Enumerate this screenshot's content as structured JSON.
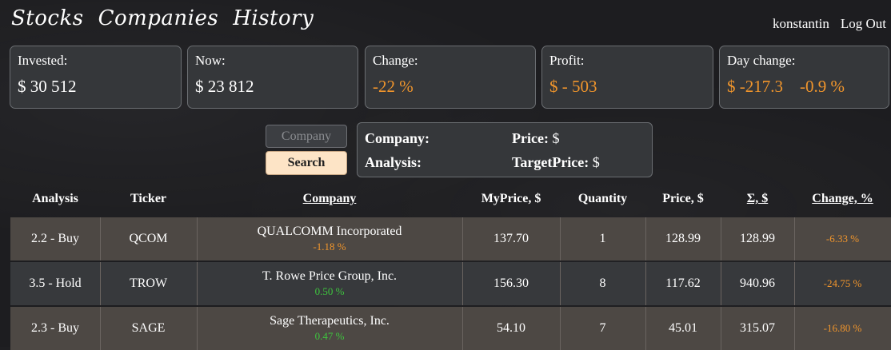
{
  "nav": {
    "links": [
      "Stocks",
      "Companies",
      "History"
    ],
    "username": "konstantin",
    "logout": "Log Out"
  },
  "summary": {
    "invested": {
      "label": "Invested:",
      "value": "$ 30 512"
    },
    "now": {
      "label": "Now:",
      "value": "$ 23 812"
    },
    "change": {
      "label": "Change:",
      "value": "-22 %"
    },
    "profit": {
      "label": "Profit:",
      "value": "$ - 503"
    },
    "day_change": {
      "label": "Day change:",
      "value": "$ -217.3    -0.9 %"
    }
  },
  "controls": {
    "company_button": "Company",
    "search_button": "Search"
  },
  "info": {
    "company_label": "Company:",
    "price_label": "Price:",
    "price_unit": "$",
    "analysis_label": "Analysis:",
    "target_label": "TargetPrice:",
    "target_unit": "$"
  },
  "table": {
    "headers": {
      "analysis": "Analysis",
      "ticker": "Ticker",
      "company": "Company",
      "myprice": "MyPrice, $",
      "quantity": "Quantity",
      "price": "Price, $",
      "sum": "Σ, $",
      "change": "Change, %"
    },
    "rows": [
      {
        "analysis": "2.2 - Buy",
        "ticker": "QCOM",
        "company": "QUALCOMM Incorporated",
        "day_change": "-1.18 %",
        "myprice": "137.70",
        "quantity": "1",
        "price": "128.99",
        "sum": "128.99",
        "change": "-6.33 %"
      },
      {
        "analysis": "3.5 - Hold",
        "ticker": "TROW",
        "company": "T. Rowe Price Group, Inc.",
        "day_change": "0.50 %",
        "myprice": "156.30",
        "quantity": "8",
        "price": "117.62",
        "sum": "940.96",
        "change": "-24.75 %"
      },
      {
        "analysis": "2.3 - Buy",
        "ticker": "SAGE",
        "company": "Sage Therapeutics, Inc.",
        "day_change": "0.47 %",
        "myprice": "54.10",
        "quantity": "7",
        "price": "45.01",
        "sum": "315.07",
        "change": "-16.80 %"
      }
    ]
  },
  "colors": {
    "positive": "#3ec43e",
    "negative": "#f0952c",
    "accent_button": "#fde4c6"
  }
}
